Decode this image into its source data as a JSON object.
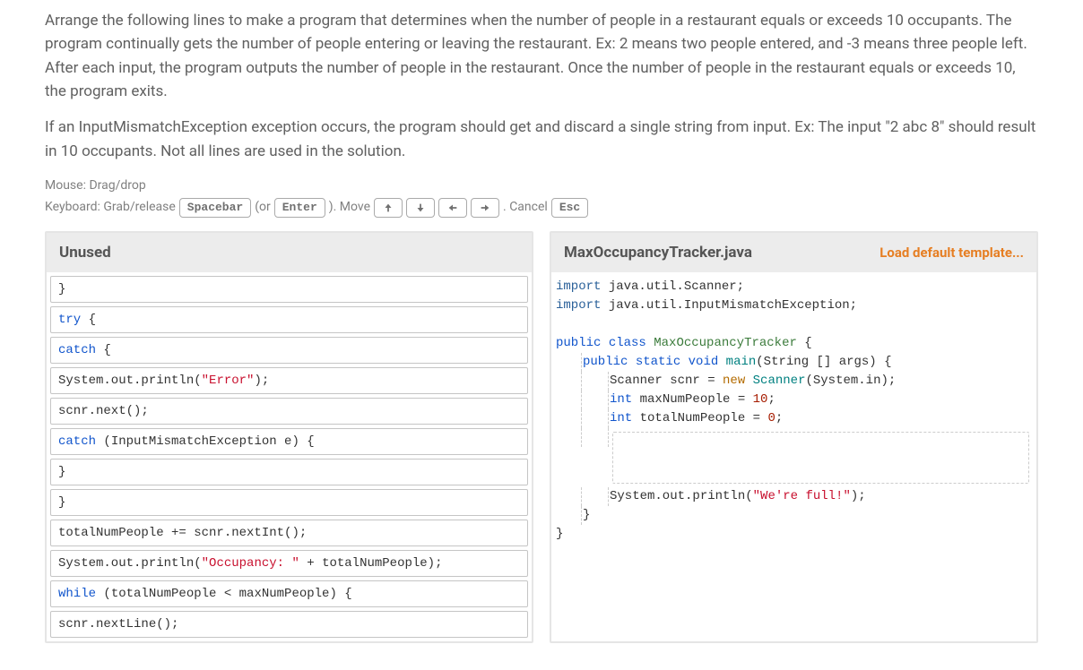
{
  "instructions": {
    "p1": "Arrange the following lines to make a program that determines when the number of people in a restaurant equals or exceeds 10 occupants. The program continually gets the number of people entering or leaving the restaurant. Ex: 2 means two people entered, and -3 means three people left. After each input, the program outputs the number of people in the restaurant. Once the number of people in the restaurant equals or exceeds 10, the program exits.",
    "p2": "If an InputMismatchException exception occurs, the program should get and discard a single string from input. Ex: The input \"2 abc 8\" should result in 10 occupants. Not all lines are used in the solution."
  },
  "controls": {
    "mouse_label": "Mouse: Drag/drop",
    "kb_label": "Keyboard: Grab/release",
    "spacebar": "Spacebar",
    "or": "(or",
    "enter": "Enter",
    "move": "). Move",
    "cancel": ". Cancel",
    "esc": "Esc"
  },
  "unused": {
    "title": "Unused",
    "blocks": [
      {
        "raw": "}",
        "html": "}"
      },
      {
        "raw": "try {",
        "html": "<span class='kw-try'>try</span> {"
      },
      {
        "raw": "catch {",
        "html": "<span class='kw-catch'>catch</span> {"
      },
      {
        "raw": "System.out.println(\"Error\");",
        "html": "System.out.println(<span class='kw-str'>\"Error\"</span>);"
      },
      {
        "raw": "scnr.next();",
        "html": "scnr.next();"
      },
      {
        "raw": "catch (InputMismatchException e) {",
        "html": "<span class='kw-catch'>catch</span> (InputMismatchException e) {"
      },
      {
        "raw": "}",
        "html": "}"
      },
      {
        "raw": "}",
        "html": "}"
      },
      {
        "raw": "totalNumPeople += scnr.nextInt();",
        "html": "totalNumPeople += scnr.nextInt();"
      },
      {
        "raw": "System.out.println(\"Occupancy: \" + totalNumPeople);",
        "html": "System.out.println(<span class='kw-str'>\"Occupancy: \"</span> + totalNumPeople);"
      },
      {
        "raw": "while (totalNumPeople < maxNumPeople) {",
        "html": "<span class='kw-blue'>while</span> (totalNumPeople &lt; maxNumPeople) {"
      },
      {
        "raw": "scnr.nextLine();",
        "html": "scnr.nextLine();"
      }
    ]
  },
  "editor": {
    "filename": "MaxOccupancyTracker.java",
    "load_template": "Load default template...",
    "lines": [
      {
        "indent": 0,
        "html": "<span class='kw-imp'>import</span> java.util.Scanner;"
      },
      {
        "indent": 0,
        "html": "<span class='kw-imp'>import</span> java.util.InputMismatchException;"
      },
      {
        "indent": 0,
        "html": ""
      },
      {
        "indent": 0,
        "html": "<span class='kw-blue'>public</span> <span class='kw-blue'>class</span> <span class='kw-class'>MaxOccupancyTracker</span> {"
      },
      {
        "indent": 1,
        "html": "<span class='kw-blue'>public</span> <span class='kw-blue'>static</span> <span class='kw-blue'>void</span> <span class='kw-type'>main</span>(String [] args) {"
      },
      {
        "indent": 2,
        "html": "Scanner scnr = <span class='kw-new'>new</span> <span class='kw-type'>Scanner</span>(System.in);"
      },
      {
        "indent": 2,
        "html": "<span class='kw-blue'>int</span> maxNumPeople = <span class='kw-num'>10</span>;"
      },
      {
        "indent": 2,
        "html": "<span class='kw-blue'>int</span> totalNumPeople = <span class='kw-num'>0</span>;"
      },
      {
        "indent": 2,
        "html": "",
        "slot": true
      },
      {
        "indent": 2,
        "html": "System.out.println(<span class='kw-str'>\"We're full!\"</span>);"
      },
      {
        "indent": 1,
        "html": "}"
      },
      {
        "indent": 0,
        "html": "}"
      }
    ]
  }
}
